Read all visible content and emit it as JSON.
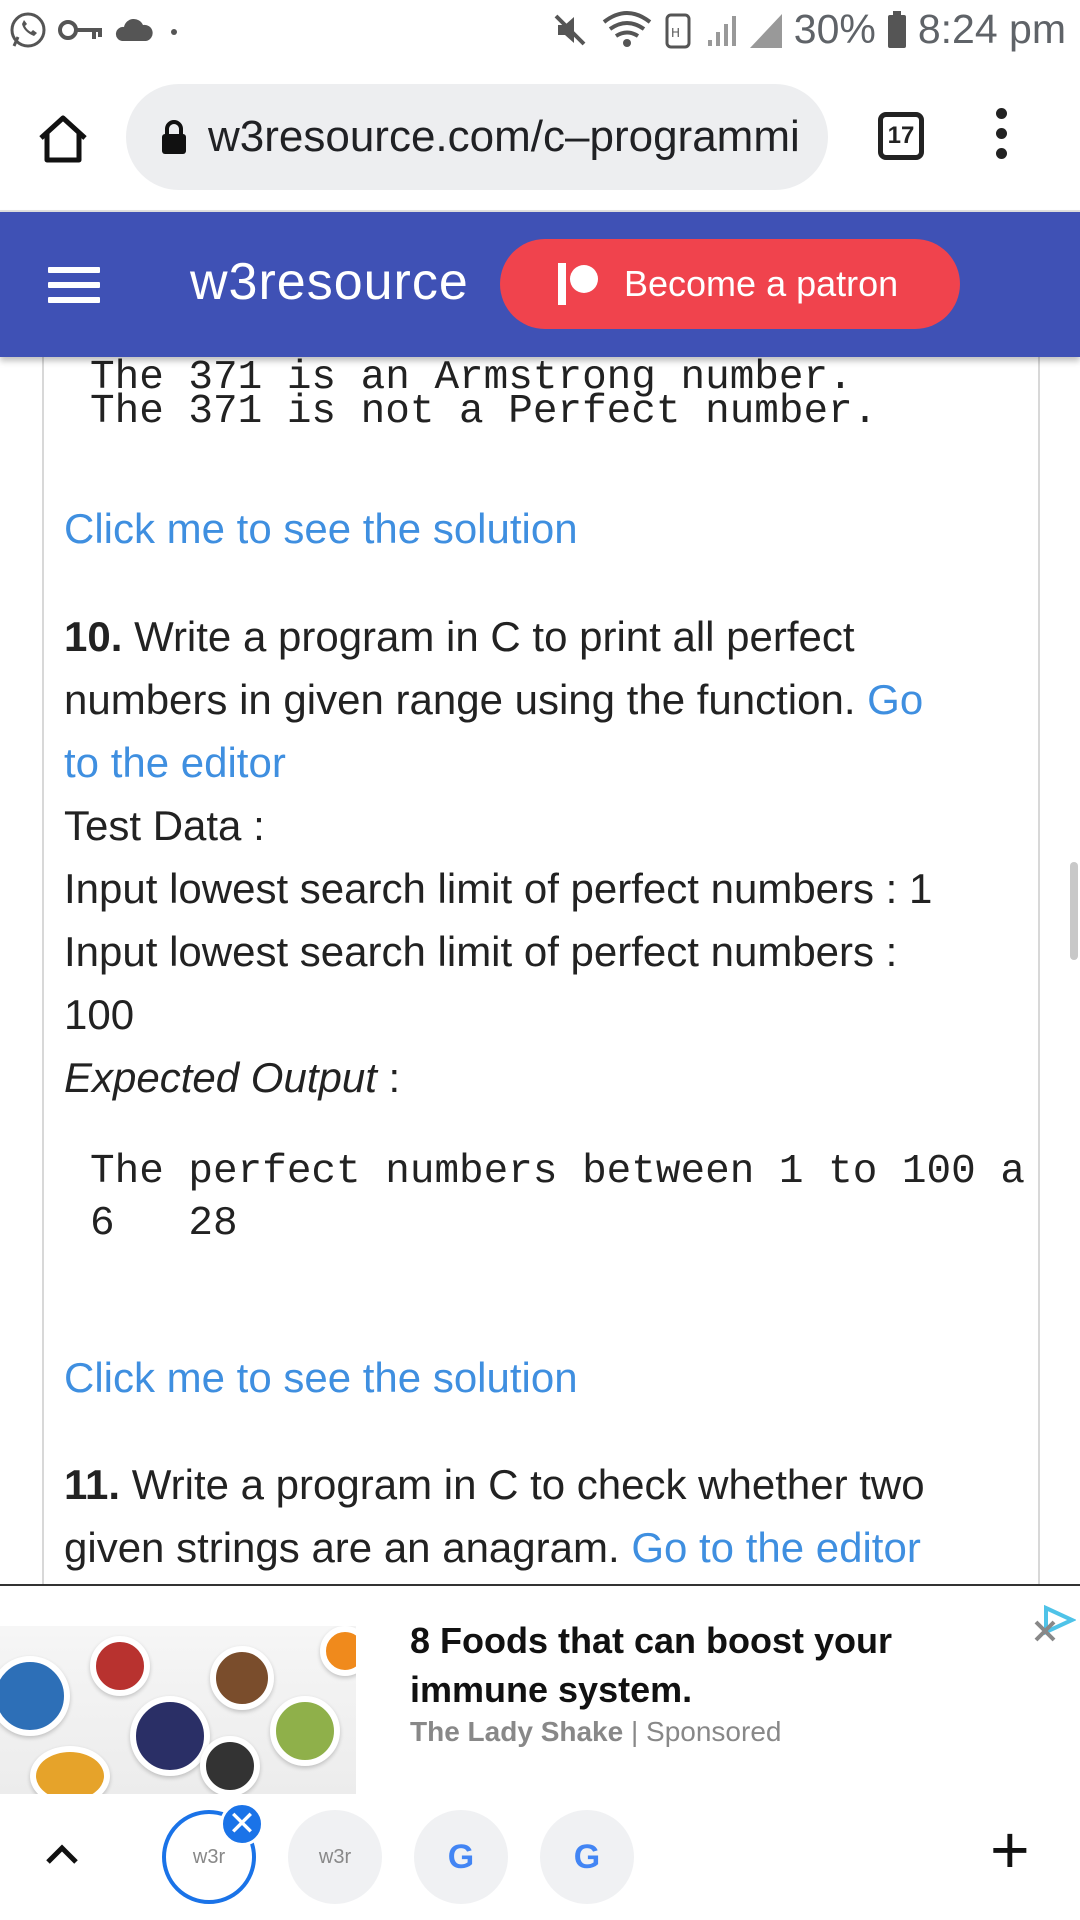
{
  "status_bar": {
    "battery": "30%",
    "time": "8:24 pm"
  },
  "browser": {
    "url": "w3resource.com/c–programmi",
    "tab_count": "17"
  },
  "site_header": {
    "brand": "w3resource",
    "patron_label": "Become a patron"
  },
  "content": {
    "output_prev_line1": "The 371 is an Armstrong number.",
    "output_prev_line2": "The 371 is not a Perfect number.",
    "solution_link_1": "Click me to see the solution",
    "q10_number": "10.",
    "q10_text_a": "Write a program in C to print all perfect",
    "q10_text_b": "numbers in given range using the function.",
    "q10_go": "Go",
    "q10_editor": "to the editor",
    "test_data_label": "Test Data :",
    "input_line_1": "Input lowest search limit of perfect numbers : 1",
    "input_line_2": "Input lowest search limit of perfect numbers :",
    "input_line_2_value": "100",
    "expected_label": "Expected Output",
    "expected_colon": " :",
    "output_line_1": "The perfect numbers between 1 to 100 a",
    "output_line_2": "6   28",
    "solution_link_2": "Click me to see the solution",
    "q11_number": "11.",
    "q11_text_a": "Write a program in C to check whether two",
    "q11_text_b": "given strings are an anagram.",
    "q11_editor": "Go to the editor"
  },
  "ad": {
    "title": "8 Foods that can boost your immune system.",
    "source": "The Lady Shake",
    "separator": "|",
    "sponsored": "Sponsored"
  },
  "bottom_bar": {
    "tab1_label": "w3r",
    "tab2_label": "w3r",
    "tab3_label": "G",
    "tab4_label": "G",
    "close_label": "✕",
    "add_label": "+"
  },
  "colors": {
    "site_header": "#3f51b5",
    "patron": "#f0434d",
    "link": "#3f8fe0",
    "active_tab": "#1a73e8"
  }
}
